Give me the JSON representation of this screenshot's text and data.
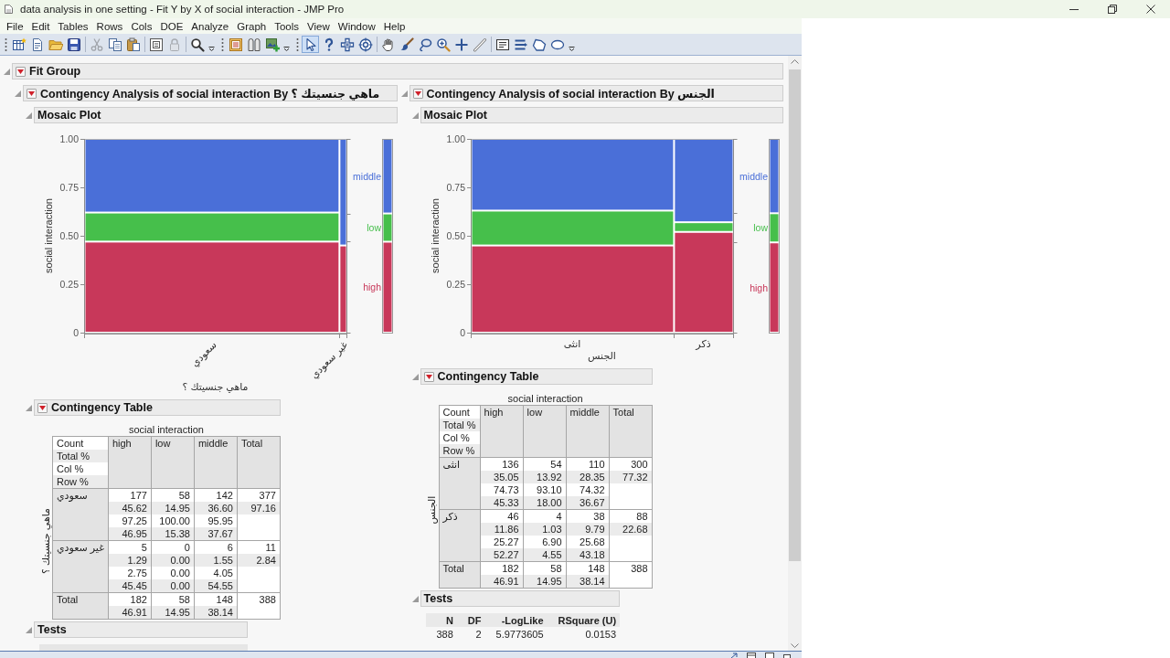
{
  "window": {
    "title": "data analysis in one setting - Fit Y by X of social interaction - JMP Pro"
  },
  "menu": [
    "File",
    "Edit",
    "Tables",
    "Rows",
    "Cols",
    "DOE",
    "Analyze",
    "Graph",
    "Tools",
    "View",
    "Window",
    "Help"
  ],
  "toolbar": [
    {
      "sections": [
        [
          {
            "kind": "newtable",
            "disabled": false
          },
          {
            "kind": "newscript",
            "disabled": false
          },
          {
            "kind": "open",
            "disabled": false
          },
          {
            "kind": "save",
            "disabled": false
          }
        ],
        [
          {
            "kind": "cut",
            "disabled": true
          },
          {
            "kind": "copy",
            "disabled": false
          },
          {
            "kind": "paste",
            "disabled": false
          }
        ],
        [
          {
            "kind": "panel",
            "disabled": false
          },
          {
            "kind": "lock",
            "disabled": true
          }
        ],
        [
          {
            "kind": "search",
            "disabled": false
          }
        ]
      ]
    },
    {
      "sections": [
        [
          {
            "kind": "journal",
            "disabled": false
          },
          {
            "kind": "columns",
            "disabled": false
          },
          {
            "kind": "addimage",
            "disabled": false
          }
        ]
      ]
    },
    {
      "sections": [
        [
          {
            "kind": "pointer",
            "selected": true
          },
          {
            "kind": "help",
            "selected": false
          },
          {
            "kind": "cross",
            "selected": false
          },
          {
            "kind": "target",
            "selected": false
          }
        ],
        [
          {
            "kind": "hand",
            "selected": false
          },
          {
            "kind": "brush",
            "selected": false
          },
          {
            "kind": "lasso",
            "selected": false
          },
          {
            "kind": "zoom",
            "selected": false
          },
          {
            "kind": "plus",
            "selected": false
          },
          {
            "kind": "line",
            "selected": false
          }
        ],
        [
          {
            "kind": "textbox",
            "selected": false
          },
          {
            "kind": "lines",
            "selected": false
          },
          {
            "kind": "polygon",
            "selected": false
          },
          {
            "kind": "oval",
            "selected": false
          }
        ]
      ]
    }
  ],
  "report": {
    "title": "Fit Group",
    "expanded": true,
    "menu_button": true,
    "analyses": [
      {
        "title": "Contingency Analysis of social interaction By ماهي جنسيتك ؟",
        "expanded": true,
        "menu_button": true,
        "mosaic": {
          "title": "Mosaic Plot",
          "expanded": true,
          "menu_button": false,
          "chart_data": {
            "type": "bar",
            "stacked": true,
            "xlabel": "ماهي جنسيتك ؟",
            "ylabel": "social interaction",
            "categories": [
              "سعودي",
              "غير سعودي"
            ],
            "series": [
              {
                "name": "high",
                "color": "#c8385a",
                "values": [
                  0.47,
                  0.45
                ]
              },
              {
                "name": "low",
                "color": "#46bf4b",
                "values": [
                  0.15,
                  0
                ]
              },
              {
                "name": "middle",
                "color": "#4a6fd8",
                "values": [
                  0.38,
                  0.55
                ]
              }
            ],
            "ylim": [
              0,
              1
            ],
            "yticks": [
              {
                "value": 0,
                "label": "0"
              },
              {
                "value": 0.25,
                "label": "0.25"
              },
              {
                "value": 0.5,
                "label": "0.50"
              },
              {
                "value": 0.75,
                "label": "0.75"
              },
              {
                "value": 1,
                "label": "1.00"
              }
            ]
          }
        },
        "contingency": {
          "title": "Contingency Table",
          "expanded": true,
          "menu_button": true,
          "column_variable": "social interaction",
          "row_variable": "ماهي جنسيتك ؟",
          "statistics": [
            "Count",
            "Total %",
            "Col %",
            "Row %"
          ],
          "columns": [
            "high",
            "low",
            "middle",
            "Total"
          ],
          "rows": [
            {
              "label": "سعودي",
              "cells": [
                [
                  "177",
                  "45.62",
                  "97.25",
                  "46.95"
                ],
                [
                  "58",
                  "14.95",
                  "100.00",
                  "15.38"
                ],
                [
                  "142",
                  "36.60",
                  "95.95",
                  "37.67"
                ],
                [
                  "377",
                  "97.16"
                ]
              ]
            },
            {
              "label": "غير سعودي",
              "cells": [
                [
                  "5",
                  "1.29",
                  "2.75",
                  "45.45"
                ],
                [
                  "0",
                  "0.00",
                  "0.00",
                  "0.00"
                ],
                [
                  "6",
                  "1.55",
                  "4.05",
                  "54.55"
                ],
                [
                  "11",
                  "2.84"
                ]
              ]
            }
          ],
          "total": {
            "label": "Total",
            "cells": [
              [
                "182",
                "46.91"
              ],
              [
                "58",
                "14.95"
              ],
              [
                "148",
                "38.14"
              ],
              [
                "388"
              ]
            ]
          }
        },
        "tests": {
          "title": "Tests",
          "expanded": true,
          "menu_button": false
        }
      },
      {
        "title": "Contingency Analysis of social interaction By الجنس",
        "expanded": true,
        "menu_button": true,
        "mosaic": {
          "title": "Mosaic Plot",
          "expanded": true,
          "menu_button": false,
          "chart_data": {
            "type": "bar",
            "stacked": true,
            "xlabel": "الجنس",
            "ylabel": "social interaction",
            "categories": [
              "انثى",
              "ذكر"
            ],
            "series": [
              {
                "name": "high",
                "color": "#c8385a",
                "values": [
                  0.45,
                  0.52
                ]
              },
              {
                "name": "low",
                "color": "#46bf4b",
                "values": [
                  0.18,
                  0.05
                ]
              },
              {
                "name": "middle",
                "color": "#4a6fd8",
                "values": [
                  0.37,
                  0.43
                ]
              }
            ],
            "ylim": [
              0,
              1
            ],
            "yticks": [
              {
                "value": 0,
                "label": "0"
              },
              {
                "value": 0.25,
                "label": "0.25"
              },
              {
                "value": 0.5,
                "label": "0.50"
              },
              {
                "value": 0.75,
                "label": "0.75"
              },
              {
                "value": 1,
                "label": "1.00"
              }
            ]
          }
        },
        "contingency": {
          "title": "Contingency Table",
          "expanded": true,
          "menu_button": true,
          "column_variable": "social interaction",
          "row_variable": "الجنس",
          "statistics": [
            "Count",
            "Total %",
            "Col %",
            "Row %"
          ],
          "columns": [
            "high",
            "low",
            "middle",
            "Total"
          ],
          "rows": [
            {
              "label": "انثى",
              "cells": [
                [
                  "136",
                  "35.05",
                  "74.73",
                  "45.33"
                ],
                [
                  "54",
                  "13.92",
                  "93.10",
                  "18.00"
                ],
                [
                  "110",
                  "28.35",
                  "74.32",
                  "36.67"
                ],
                [
                  "300",
                  "77.32"
                ]
              ]
            },
            {
              "label": "ذكر",
              "cells": [
                [
                  "46",
                  "11.86",
                  "25.27",
                  "52.27"
                ],
                [
                  "4",
                  "1.03",
                  "6.90",
                  "4.55"
                ],
                [
                  "38",
                  "9.79",
                  "25.68",
                  "43.18"
                ],
                [
                  "88",
                  "22.68"
                ]
              ]
            }
          ],
          "total": {
            "label": "Total",
            "cells": [
              [
                "182",
                "46.91"
              ],
              [
                "58",
                "14.95"
              ],
              [
                "148",
                "38.14"
              ],
              [
                "388"
              ]
            ]
          }
        },
        "tests": {
          "title": "Tests",
          "expanded": true,
          "menu_button": false,
          "columns": [
            "N",
            "DF",
            "-LogLike",
            "RSquare (U)"
          ],
          "rows": [
            [
              "388",
              "2",
              "5.9773605",
              "0.0153"
            ]
          ]
        }
      }
    ]
  }
}
